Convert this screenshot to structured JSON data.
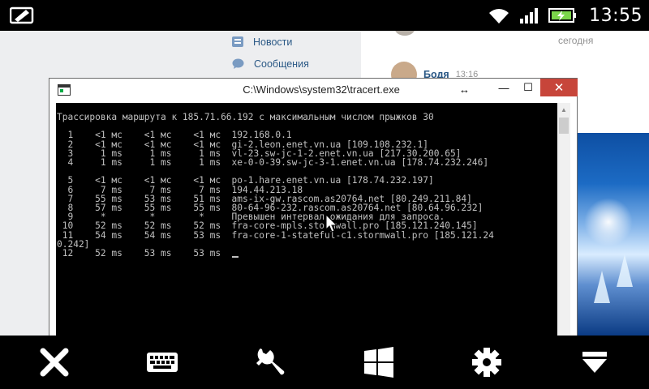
{
  "status_bar": {
    "time": "13:55",
    "icons": [
      "image-edit-icon",
      "wifi-icon",
      "signal-icon",
      "battery-charging-icon"
    ]
  },
  "vk": {
    "nav": [
      {
        "label": "Новости",
        "icon": "news-icon"
      },
      {
        "label": "Сообщения",
        "icon": "messages-icon"
      }
    ],
    "today_label": "сегодня",
    "message": {
      "name": "Бодя",
      "time": "13:16"
    }
  },
  "window": {
    "title": "C:\\Windows\\system32\\tracert.exe",
    "minimize": "—",
    "maximize": "☐",
    "close": "✕"
  },
  "console": {
    "header": "Трассировка маршрута к 185.71.66.192 с максимальным числом прыжков 30",
    "hops": [
      "  1    <1 мс    <1 мс    <1 мс  192.168.0.1",
      "  2    <1 мс    <1 мс    <1 мс  gi-2.leon.enet.vn.ua [109.108.232.1]",
      "  3     1 ms     1 ms     1 ms  vl-23.sw-jc-1-2.enet.vn.ua [217.30.200.65]",
      "  4     1 ms     1 ms     1 ms  xe-0-0-39.sw-jc-3-1.enet.vn.ua [178.74.232.246]",
      "  5    <1 мс    <1 мс    <1 мс  po-1.hare.enet.vn.ua [178.74.232.197]",
      "  6     7 ms     7 ms     7 ms  194.44.213.18",
      "  7    55 ms    53 ms    51 ms  ams-ix-gw.rascom.as20764.net [80.249.211.84]",
      "  8    57 ms    55 ms    55 ms  80-64-96-232.rascom.as20764.net [80.64.96.232]",
      "  9     *        *        *     Превышен интервал ожидания для запроса.",
      " 10    52 ms    52 ms    52 ms  fra-core-mpls.stormwall.pro [185.121.240.145]",
      " 11    54 ms    54 ms    53 ms  fra-core-1-stateful-c1.stormwall.pro [185.121.24",
      "0.242]",
      " 12    52 ms    53 ms    53 ms  "
    ]
  },
  "toolbar": [
    {
      "name": "close-session-button",
      "icon": "close-x-icon"
    },
    {
      "name": "keyboard-button",
      "icon": "keyboard-icon"
    },
    {
      "name": "tools-button",
      "icon": "wrench-icon"
    },
    {
      "name": "windows-start-button",
      "icon": "windows-logo-icon"
    },
    {
      "name": "settings-button",
      "icon": "gear-icon"
    },
    {
      "name": "hide-toolbar-button",
      "icon": "eject-icon"
    }
  ],
  "colors": {
    "close_button": "#c7453a",
    "console_text": "#c0c0c0",
    "vk_link": "#2a5885"
  }
}
